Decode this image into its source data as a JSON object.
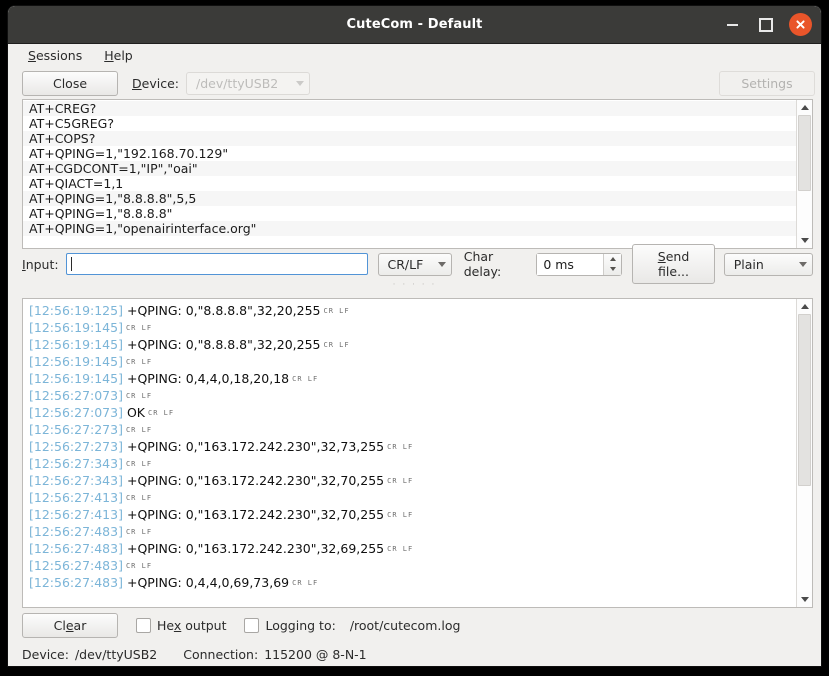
{
  "window": {
    "title": "CuteCom - Default",
    "minimize_label": "minimize",
    "maximize_label": "maximize",
    "close_label": "close"
  },
  "menubar": {
    "items": [
      {
        "label": "Sessions",
        "mnemonic": "S"
      },
      {
        "label": "Help",
        "mnemonic": "H"
      }
    ]
  },
  "toolbar": {
    "connect_button": "Close",
    "device_label": "Device:",
    "device_value": "/dev/ttyUSB2",
    "settings_button": "Settings"
  },
  "history": {
    "items": [
      "AT+CREG?",
      "AT+C5GREG?",
      "AT+COPS?",
      "AT+QPING=1,\"192.168.70.129\"",
      "AT+CGDCONT=1,\"IP\",\"oai\"",
      "AT+QIACT=1,1",
      "AT+QPING=1,\"8.8.8.8\",5,5",
      "AT+QPING=1,\"8.8.8.8\"",
      "AT+QPING=1,\"openairinterface.org\""
    ]
  },
  "input_row": {
    "label": "Input:",
    "value": "",
    "placeholder": "",
    "line_ending": "CR/LF",
    "char_delay_label": "Char delay:",
    "char_delay_value": "0 ms",
    "send_file_button": "Send file...",
    "send_mode": "Plain"
  },
  "log": {
    "lines": [
      {
        "ts": "[12:56:19:125]",
        "msg": "+QPING: 0,\"8.8.8.8\",32,20,255",
        "ctl": "CR LF"
      },
      {
        "ts": "[12:56:19:145]",
        "msg": "",
        "ctl": "CR LF"
      },
      {
        "ts": "[12:56:19:145]",
        "msg": "+QPING: 0,\"8.8.8.8\",32,20,255",
        "ctl": "CR LF"
      },
      {
        "ts": "[12:56:19:145]",
        "msg": "",
        "ctl": "CR LF"
      },
      {
        "ts": "[12:56:19:145]",
        "msg": "+QPING: 0,4,4,0,18,20,18",
        "ctl": "CR LF"
      },
      {
        "ts": "[12:56:27:073]",
        "msg": "",
        "ctl": "CR LF"
      },
      {
        "ts": "[12:56:27:073]",
        "msg": "OK",
        "ctl": "CR LF"
      },
      {
        "ts": "[12:56:27:273]",
        "msg": "",
        "ctl": "CR LF"
      },
      {
        "ts": "[12:56:27:273]",
        "msg": "+QPING: 0,\"163.172.242.230\",32,73,255",
        "ctl": "CR LF"
      },
      {
        "ts": "[12:56:27:343]",
        "msg": "",
        "ctl": "CR LF"
      },
      {
        "ts": "[12:56:27:343]",
        "msg": "+QPING: 0,\"163.172.242.230\",32,70,255",
        "ctl": "CR LF"
      },
      {
        "ts": "[12:56:27:413]",
        "msg": "",
        "ctl": "CR LF"
      },
      {
        "ts": "[12:56:27:413]",
        "msg": "+QPING: 0,\"163.172.242.230\",32,70,255",
        "ctl": "CR LF"
      },
      {
        "ts": "[12:56:27:483]",
        "msg": "",
        "ctl": "CR LF"
      },
      {
        "ts": "[12:56:27:483]",
        "msg": "+QPING: 0,\"163.172.242.230\",32,69,255",
        "ctl": "CR LF"
      },
      {
        "ts": "[12:56:27:483]",
        "msg": "",
        "ctl": "CR LF"
      },
      {
        "ts": "[12:56:27:483]",
        "msg": "+QPING: 0,4,4,0,69,73,69",
        "ctl": "CR LF"
      }
    ]
  },
  "bottom_bar": {
    "clear_button": "Clear",
    "hex_output_label": "Hex output",
    "hex_output_checked": false,
    "logging_label": "Logging to:",
    "logging_checked": false,
    "log_path": "/root/cutecom.log"
  },
  "status_bar": {
    "device_label": "Device:",
    "device_value": "/dev/ttyUSB2",
    "connection_label": "Connection:",
    "connection_value": "115200 @ 8-N-1"
  },
  "colors": {
    "titlebar_bg": "#3b3b39",
    "close_button": "#e9552a",
    "timestamp": "#7cb5d8",
    "focus_border": "#5294d6",
    "window_bg": "#f1f0ee"
  }
}
